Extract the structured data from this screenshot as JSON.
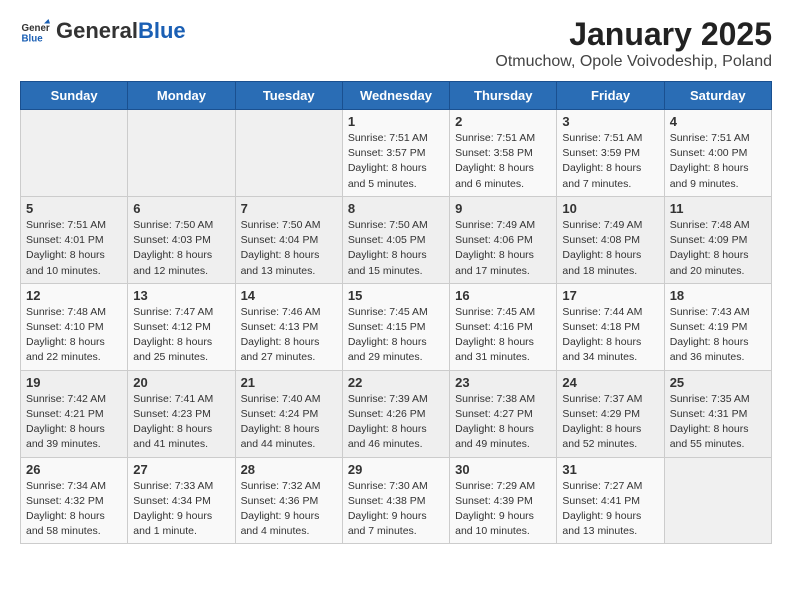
{
  "header": {
    "logo_general": "General",
    "logo_blue": "Blue",
    "main_title": "January 2025",
    "subtitle": "Otmuchow, Opole Voivodeship, Poland"
  },
  "weekdays": [
    "Sunday",
    "Monday",
    "Tuesday",
    "Wednesday",
    "Thursday",
    "Friday",
    "Saturday"
  ],
  "weeks": [
    [
      {
        "day": "",
        "info": ""
      },
      {
        "day": "",
        "info": ""
      },
      {
        "day": "",
        "info": ""
      },
      {
        "day": "1",
        "info": "Sunrise: 7:51 AM\nSunset: 3:57 PM\nDaylight: 8 hours and 5 minutes."
      },
      {
        "day": "2",
        "info": "Sunrise: 7:51 AM\nSunset: 3:58 PM\nDaylight: 8 hours and 6 minutes."
      },
      {
        "day": "3",
        "info": "Sunrise: 7:51 AM\nSunset: 3:59 PM\nDaylight: 8 hours and 7 minutes."
      },
      {
        "day": "4",
        "info": "Sunrise: 7:51 AM\nSunset: 4:00 PM\nDaylight: 8 hours and 9 minutes."
      }
    ],
    [
      {
        "day": "5",
        "info": "Sunrise: 7:51 AM\nSunset: 4:01 PM\nDaylight: 8 hours and 10 minutes."
      },
      {
        "day": "6",
        "info": "Sunrise: 7:50 AM\nSunset: 4:03 PM\nDaylight: 8 hours and 12 minutes."
      },
      {
        "day": "7",
        "info": "Sunrise: 7:50 AM\nSunset: 4:04 PM\nDaylight: 8 hours and 13 minutes."
      },
      {
        "day": "8",
        "info": "Sunrise: 7:50 AM\nSunset: 4:05 PM\nDaylight: 8 hours and 15 minutes."
      },
      {
        "day": "9",
        "info": "Sunrise: 7:49 AM\nSunset: 4:06 PM\nDaylight: 8 hours and 17 minutes."
      },
      {
        "day": "10",
        "info": "Sunrise: 7:49 AM\nSunset: 4:08 PM\nDaylight: 8 hours and 18 minutes."
      },
      {
        "day": "11",
        "info": "Sunrise: 7:48 AM\nSunset: 4:09 PM\nDaylight: 8 hours and 20 minutes."
      }
    ],
    [
      {
        "day": "12",
        "info": "Sunrise: 7:48 AM\nSunset: 4:10 PM\nDaylight: 8 hours and 22 minutes."
      },
      {
        "day": "13",
        "info": "Sunrise: 7:47 AM\nSunset: 4:12 PM\nDaylight: 8 hours and 25 minutes."
      },
      {
        "day": "14",
        "info": "Sunrise: 7:46 AM\nSunset: 4:13 PM\nDaylight: 8 hours and 27 minutes."
      },
      {
        "day": "15",
        "info": "Sunrise: 7:45 AM\nSunset: 4:15 PM\nDaylight: 8 hours and 29 minutes."
      },
      {
        "day": "16",
        "info": "Sunrise: 7:45 AM\nSunset: 4:16 PM\nDaylight: 8 hours and 31 minutes."
      },
      {
        "day": "17",
        "info": "Sunrise: 7:44 AM\nSunset: 4:18 PM\nDaylight: 8 hours and 34 minutes."
      },
      {
        "day": "18",
        "info": "Sunrise: 7:43 AM\nSunset: 4:19 PM\nDaylight: 8 hours and 36 minutes."
      }
    ],
    [
      {
        "day": "19",
        "info": "Sunrise: 7:42 AM\nSunset: 4:21 PM\nDaylight: 8 hours and 39 minutes."
      },
      {
        "day": "20",
        "info": "Sunrise: 7:41 AM\nSunset: 4:23 PM\nDaylight: 8 hours and 41 minutes."
      },
      {
        "day": "21",
        "info": "Sunrise: 7:40 AM\nSunset: 4:24 PM\nDaylight: 8 hours and 44 minutes."
      },
      {
        "day": "22",
        "info": "Sunrise: 7:39 AM\nSunset: 4:26 PM\nDaylight: 8 hours and 46 minutes."
      },
      {
        "day": "23",
        "info": "Sunrise: 7:38 AM\nSunset: 4:27 PM\nDaylight: 8 hours and 49 minutes."
      },
      {
        "day": "24",
        "info": "Sunrise: 7:37 AM\nSunset: 4:29 PM\nDaylight: 8 hours and 52 minutes."
      },
      {
        "day": "25",
        "info": "Sunrise: 7:35 AM\nSunset: 4:31 PM\nDaylight: 8 hours and 55 minutes."
      }
    ],
    [
      {
        "day": "26",
        "info": "Sunrise: 7:34 AM\nSunset: 4:32 PM\nDaylight: 8 hours and 58 minutes."
      },
      {
        "day": "27",
        "info": "Sunrise: 7:33 AM\nSunset: 4:34 PM\nDaylight: 9 hours and 1 minute."
      },
      {
        "day": "28",
        "info": "Sunrise: 7:32 AM\nSunset: 4:36 PM\nDaylight: 9 hours and 4 minutes."
      },
      {
        "day": "29",
        "info": "Sunrise: 7:30 AM\nSunset: 4:38 PM\nDaylight: 9 hours and 7 minutes."
      },
      {
        "day": "30",
        "info": "Sunrise: 7:29 AM\nSunset: 4:39 PM\nDaylight: 9 hours and 10 minutes."
      },
      {
        "day": "31",
        "info": "Sunrise: 7:27 AM\nSunset: 4:41 PM\nDaylight: 9 hours and 13 minutes."
      },
      {
        "day": "",
        "info": ""
      }
    ]
  ]
}
